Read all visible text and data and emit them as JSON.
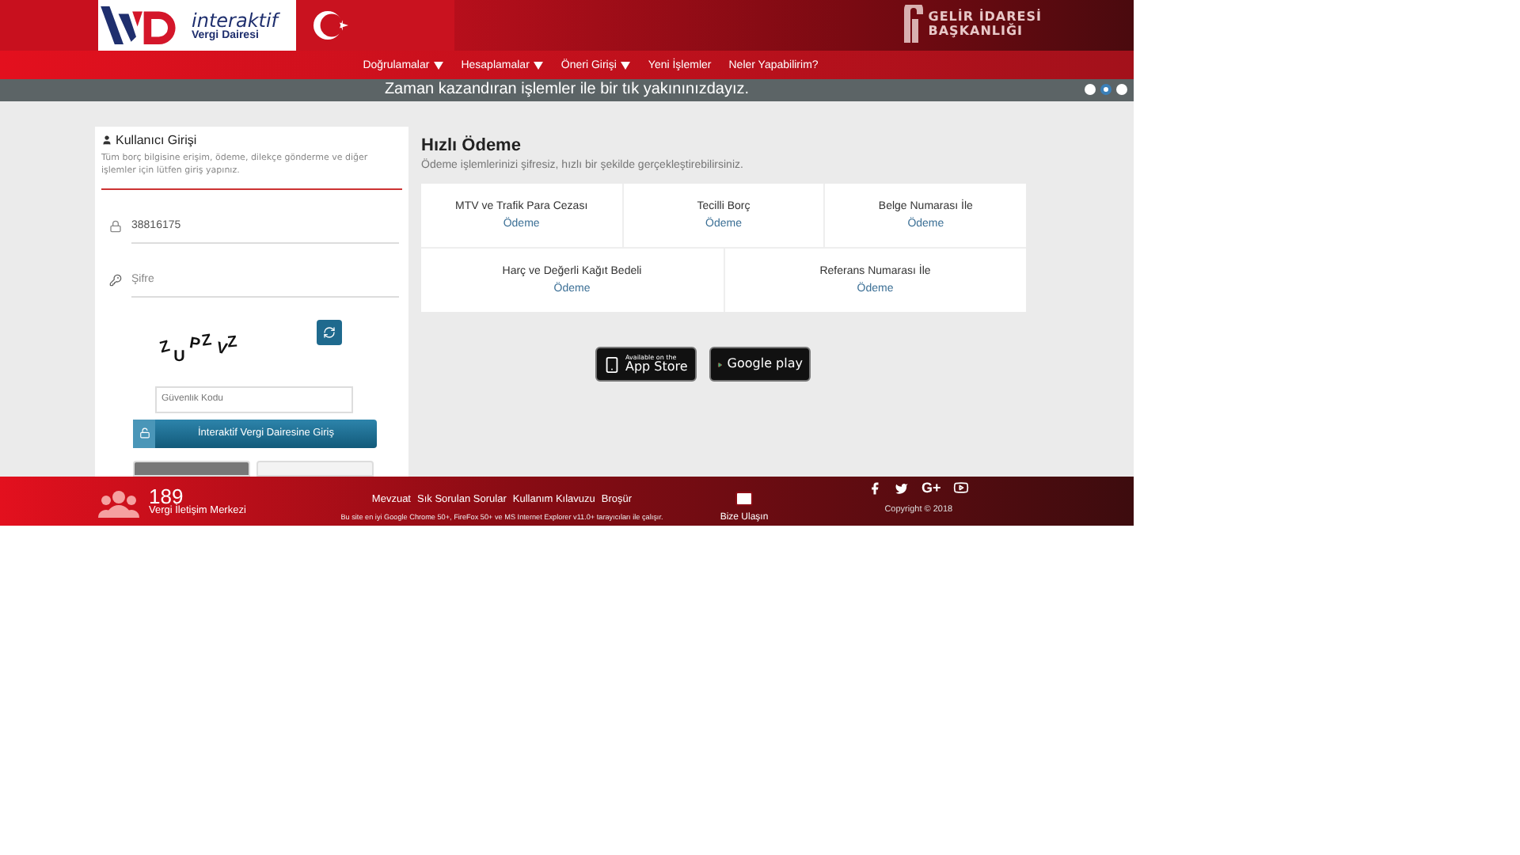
{
  "header": {
    "logo_line1": "interaktif",
    "logo_line2": "Vergi Dairesi",
    "agency_line1": "GELİR İDARESİ",
    "agency_line2": "BAŞKANLIĞI"
  },
  "nav": [
    {
      "label": "Doğrulamalar",
      "caret": true
    },
    {
      "label": "Hesaplamalar",
      "caret": true
    },
    {
      "label": "Öneri Girişi",
      "caret": true
    },
    {
      "label": "Yeni İşlemler",
      "caret": false
    },
    {
      "label": "Neler Yapabilirim?",
      "caret": false
    }
  ],
  "banner": {
    "text": "Zaman kazandıran işlemler ile bir tık yakınınızdayız.",
    "dots": [
      {
        "selected": false
      },
      {
        "selected": true
      },
      {
        "selected": false
      }
    ]
  },
  "login": {
    "title": "Kullanıcı Girişi",
    "description": "Tüm borç bilgisine erişim, ödeme, dilekçe gönderme ve diğer işlemler için lütfen giriş yapınız.",
    "username": "38816175",
    "password_placeholder": "Şifre",
    "captcha": "ZUPZVZ",
    "security_placeholder": "Güvenlik Kodu",
    "submit": "İnteraktif Vergi Dairesine Giriş"
  },
  "quick_pay": {
    "title": "Hızlı Ödeme",
    "subtitle": "Ödeme işlemlerinizi şifresiz, hızlı bir şekilde gerçekleştirebilirsiniz.",
    "rows": [
      [
        {
          "name": "MTV ve Trafik Para Cezası",
          "link": "Ödeme"
        },
        {
          "name": "Tecilli Borç",
          "link": "Ödeme"
        },
        {
          "name": "Belge Numarası İle",
          "link": "Ödeme"
        }
      ],
      [
        {
          "name": "Harç ve Değerli Kağıt Bedeli",
          "link": "Ödeme"
        },
        {
          "name": "Referans Numarası İle",
          "link": "Ödeme"
        }
      ]
    ]
  },
  "stores": [
    {
      "kind": "apple",
      "small": "Available on the",
      "big": "App Store"
    },
    {
      "kind": "google",
      "big": "Google play"
    }
  ],
  "footer": {
    "number": "189",
    "center_name": "Vergi İletişim Merkezi",
    "links": [
      "Mevzuat",
      "Sık Sorulan Sorular",
      "Kullanım Kılavuzu",
      "Broşür"
    ],
    "browser_note": "Bu site en iyi Google Chrome 50+, FireFox 50+ ve MS Internet Explorer v11.0+ tarayıcıları ile çalışır.",
    "contact": "Bize Ulaşın",
    "social": [
      {
        "kind": "facebook"
      },
      {
        "kind": "twitter"
      },
      {
        "kind": "text",
        "label": "G+"
      },
      {
        "kind": "youtube"
      }
    ],
    "copyright": "Copyright © 2018"
  }
}
